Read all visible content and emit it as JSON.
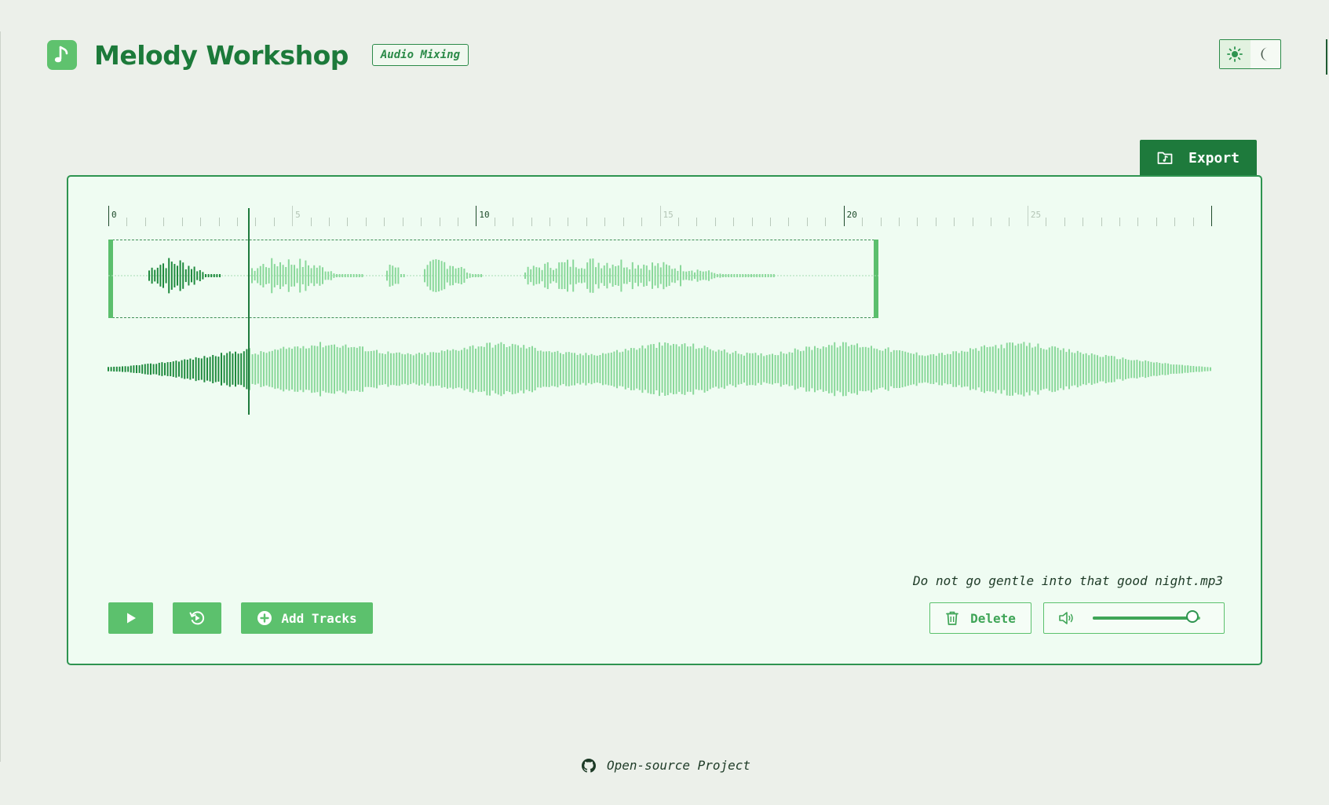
{
  "app": {
    "title": "Melody Workshop",
    "badge": "Audio Mixing",
    "logo_icon": "music-note-icon"
  },
  "theme": {
    "options": [
      "light",
      "dark"
    ],
    "active": "light",
    "icons": [
      "sun-icon",
      "moon-icon"
    ]
  },
  "export_label": "Export",
  "timeline": {
    "labels": [
      "0",
      "5",
      "10",
      "15",
      "20",
      "25"
    ],
    "max_seconds": 30,
    "playhead_seconds": 3.8
  },
  "clip": {
    "start_seconds": 0,
    "end_seconds": 20.9
  },
  "track": {
    "filename": "Do not go gentle into that good night.mp3"
  },
  "controls": {
    "add_tracks_label": "Add Tracks",
    "delete_label": "Delete",
    "volume_level": 0.93
  },
  "footer": {
    "text": "Open-source Project",
    "icon": "github-icon"
  },
  "colors": {
    "primary": "#1e7a3c",
    "accent": "#5cc16d",
    "played_wave": "#1f8a3e",
    "unplayed_wave": "#8ad89a",
    "background": "#ecf0ea",
    "panel": "#effcf2"
  }
}
